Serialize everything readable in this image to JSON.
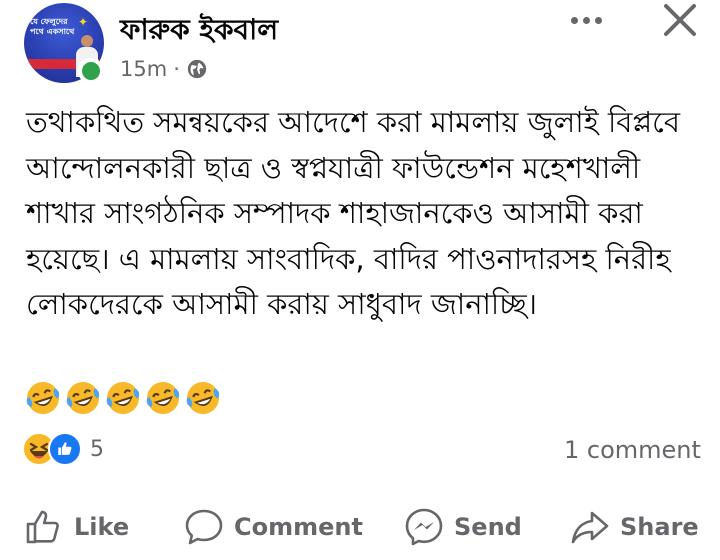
{
  "post": {
    "avatar_text": "যে ফেলুদের পথে একসাথে",
    "author_name": "ফারুক ইকবাল",
    "time": "15m",
    "separator": "·",
    "text": "তথাকথিত সমন্বয়কের আদেশে করা মামলায় জুলাই বিপ্লবে আন্দোলনকারী ছাত্র ও স্বপ্নযাত্রী ফাউন্ডেশন মহেশখালী শাখার সাংগঠনিক সম্পাদক শাহাজানকেও আসামী করা হয়েছে। এ মামলায় সাংবাদিক, বাদির পাওনাদারসহ নিরীহ লোকদেরকে আসামী করায় সাধুবাদ জানাচ্ছি।",
    "emoji_count": 5
  },
  "reactions": {
    "count": "5",
    "types": [
      "haha",
      "like"
    ]
  },
  "comments": {
    "label": "1 comment"
  },
  "actions": {
    "like": "Like",
    "comment": "Comment",
    "send": "Send",
    "share": "Share"
  },
  "colors": {
    "text": "#050505",
    "secondary": "#65676b",
    "like_blue": "#1877f2",
    "online_green": "#31a24c",
    "emoji_yellow": "#f7b928"
  },
  "icons": {
    "more": "more-dots-icon",
    "close": "close-icon",
    "audience": "globe-icon",
    "like": "thumbs-up-icon",
    "comment": "speech-bubble-icon",
    "send": "messenger-icon",
    "share": "share-arrow-icon"
  }
}
